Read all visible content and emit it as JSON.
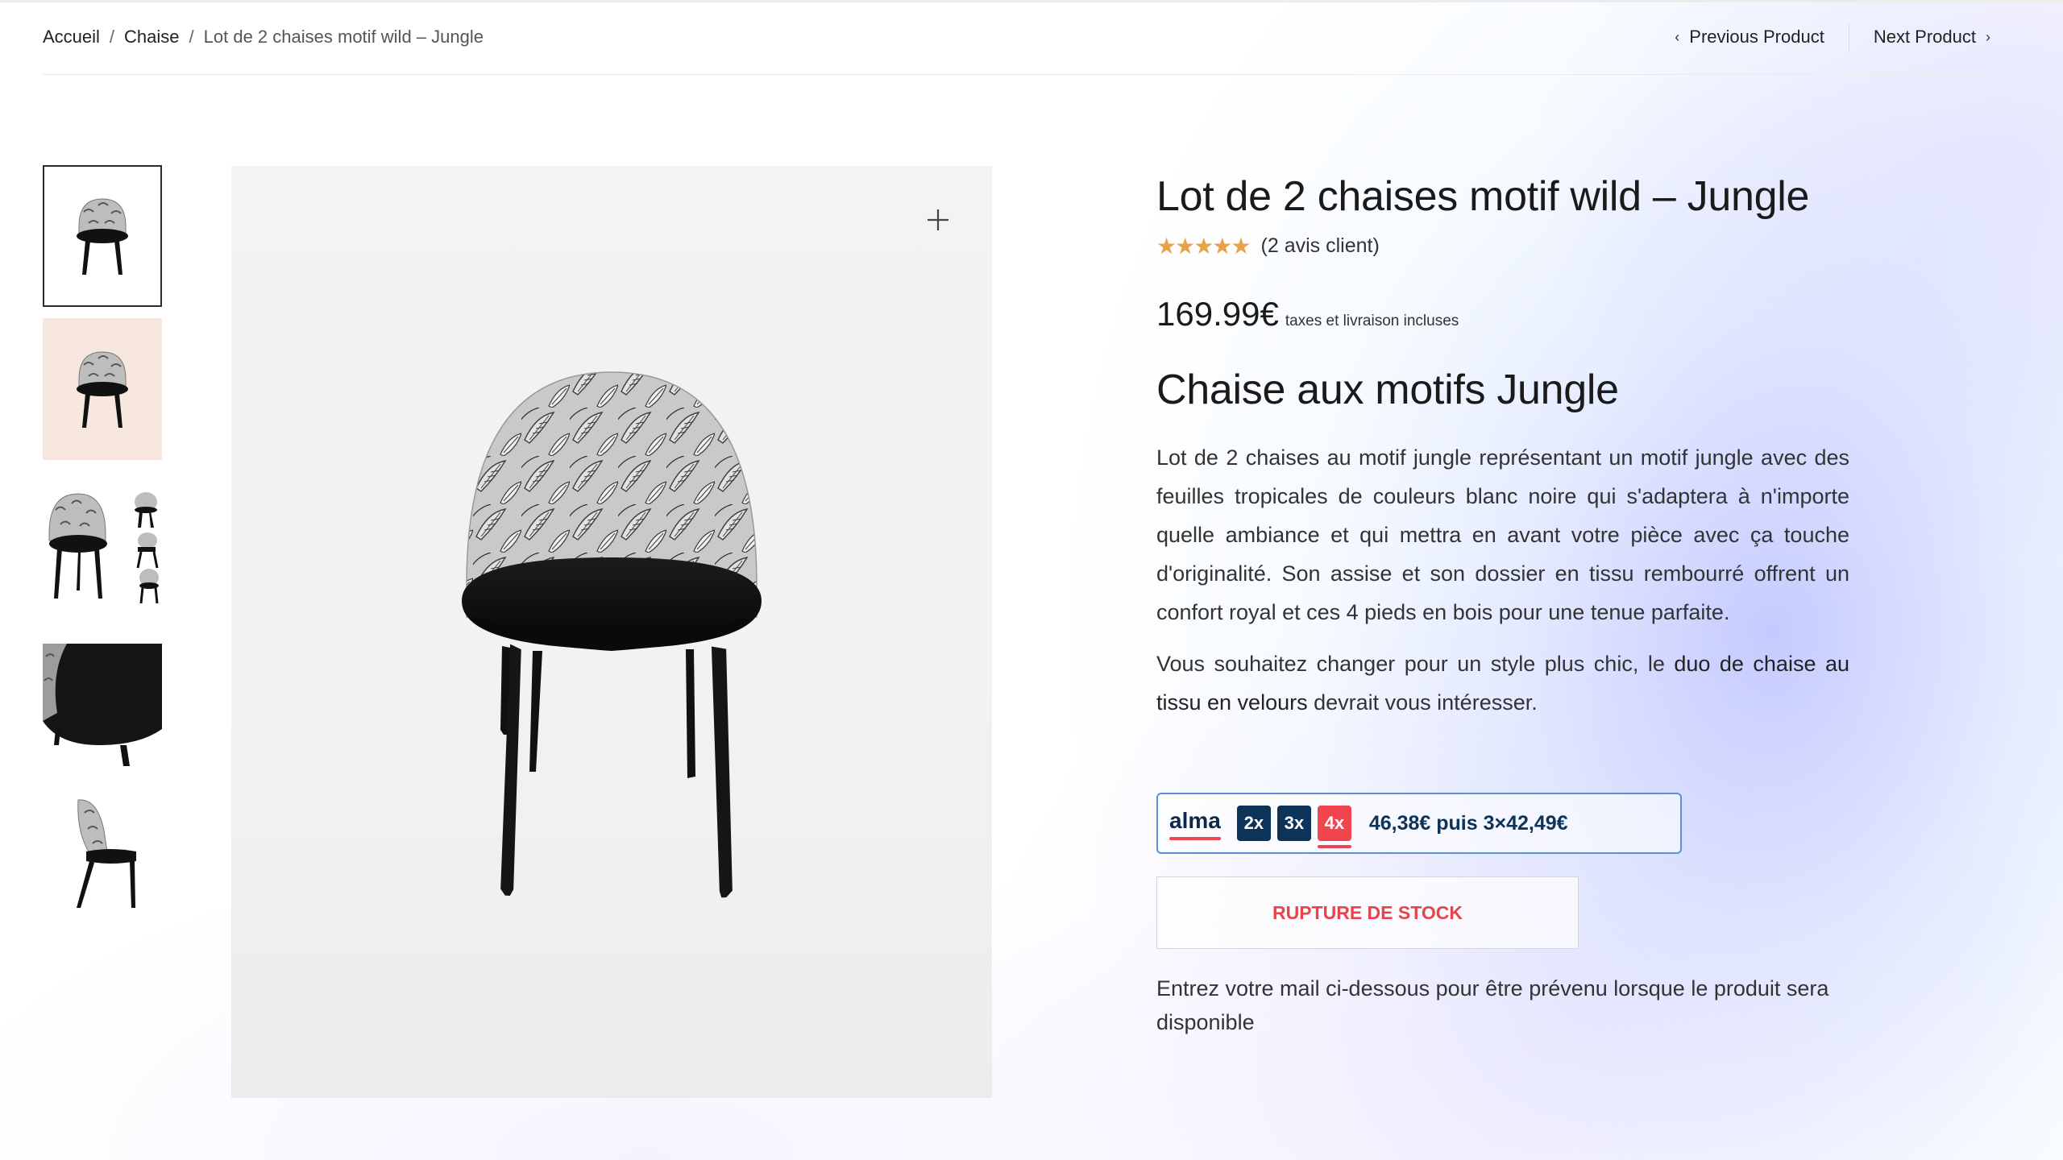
{
  "breadcrumb": {
    "items": [
      "Accueil",
      "Chaise"
    ],
    "separator": "/",
    "current": "Lot de 2 chaises motif wild – Jungle"
  },
  "product_nav": {
    "previous_label": "Previous Product",
    "next_label": "Next Product"
  },
  "gallery": {
    "thumbnails": [
      {
        "name": "front-view",
        "active": true
      },
      {
        "name": "front-view-peach-background",
        "active": false
      },
      {
        "name": "multi-angle-view",
        "active": false
      },
      {
        "name": "seat-detail",
        "active": false
      },
      {
        "name": "side-view",
        "active": false
      }
    ],
    "zoom_icon": "plus-icon"
  },
  "product": {
    "title": "Lot de 2 chaises motif wild – Jungle",
    "rating_stars": 5,
    "rating_text": "(2 avis client)",
    "price": "169.99€",
    "price_note": "taxes et livraison incluses",
    "subtitle": "Chaise aux motifs Jungle",
    "description_p1": "Lot de 2 chaises au motif jungle représentant un motif jungle avec des feuilles tropicales de couleurs blanc noire qui s'adaptera à n'importe quelle ambiance et qui mettra en avant votre pièce avec ça touche d'originalité. Son assise et son dossier en tissu rembourré offrent un confort royal et ces 4 pieds en bois pour une tenue parfaite.",
    "description_p2_before": "Vous souhaitez changer pour un style plus chic, le ",
    "description_p2_link": "duo de chaise au tissu en velours",
    "description_p2_after": " devrait vous intéresser."
  },
  "alma": {
    "logo": "alma",
    "options": [
      "2x",
      "3x",
      "4x"
    ],
    "selected": "4x",
    "installment_text": "46,38€ puis 3×42,49€",
    "colors": {
      "navy": "#0d3358",
      "accent": "#f0444e",
      "border": "#5b8fd8"
    }
  },
  "stock": {
    "status_label": "RUPTURE DE STOCK",
    "notify_text": "Entrez votre mail ci-dessous pour être prévenu lorsque le produit sera disponible"
  }
}
